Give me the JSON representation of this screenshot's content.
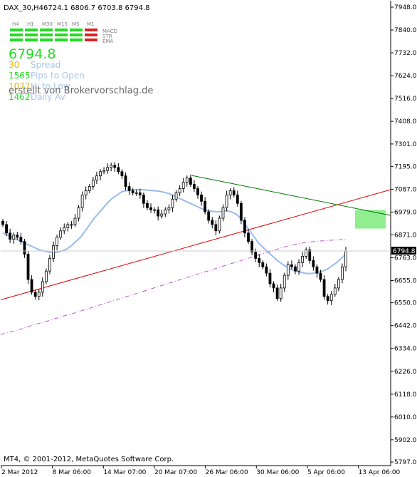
{
  "header": {
    "symbol": "DAX_30,H4",
    "ohlc": "6724.1 6806.7 6703.8 6794.8"
  },
  "indicator_panel": {
    "timeframes": [
      "H4",
      "H1",
      "M30",
      "M15",
      "M5",
      "M1"
    ],
    "signal_labels": [
      "MACD",
      "STR",
      "EMA"
    ],
    "signal_colors": {
      "H4": [
        "#22dd22",
        "#22dd22",
        "#22dd22"
      ],
      "H1": [
        "#22dd22",
        "#22dd22",
        "#22dd22"
      ],
      "M30": [
        "#22dd22",
        "#22dd22",
        "#22dd22"
      ],
      "M15": [
        "#22dd22",
        "#22dd22",
        "#22dd22"
      ],
      "M5": [
        "#22dd22",
        "#22dd22",
        "#22dd22"
      ],
      "M1": [
        "#dd2222",
        "#dd2222",
        "#dd2222"
      ]
    },
    "price": "6794.8",
    "stats": [
      {
        "value": "30",
        "label": "Spread",
        "value_color": "#e6b800"
      },
      {
        "value": "1565",
        "label": "Pips to Open",
        "value_color": "#22dd22"
      },
      {
        "value": "1077",
        "label": "Hi to Low",
        "value_color": "#e6b800"
      },
      {
        "value": "1462",
        "label": "Daily Av",
        "value_color": "#22dd22"
      }
    ]
  },
  "watermark": "erstellt von Brokervorschlag.de",
  "footer": "MT4, © 2001-2012, MetaQuotes Software Corp.",
  "chart_data": {
    "type": "candlestick",
    "y_ticks": [
      "7948.0",
      "7840.0",
      "7732.0",
      "7624.0",
      "7516.0",
      "7408.0",
      "7301.0",
      "7195.0",
      "7087.0",
      "6979.0",
      "6871.0",
      "6763.0",
      "6655.0",
      "6550.0",
      "6442.0",
      "6334.0",
      "6226.0",
      "6118.0",
      "6010.0",
      "5902.0",
      "5797.0"
    ],
    "ylim": [
      5797,
      7948
    ],
    "current_price": "6794.8",
    "x_ticks": [
      "2 Mar 2012",
      "8 Mar 06:00",
      "14 Mar 07:00",
      "20 Mar 07:00",
      "26 Mar 06:00",
      "30 Mar 06:00",
      "5 Apr 06:00",
      "13 Apr 06:00"
    ],
    "colors": {
      "candle": "#000000",
      "ma_fast": "#99bbee",
      "ma_slow": "#bb55cc",
      "support": "#dd0000",
      "resistance": "#007700",
      "box": "#90ee90"
    },
    "close": [
      6920,
      6880,
      6850,
      6870,
      6860,
      6840,
      6780,
      6660,
      6600,
      6580,
      6600,
      6650,
      6700,
      6760,
      6820,
      6860,
      6890,
      6905,
      6920,
      6920,
      6950,
      7000,
      7060,
      7080,
      7100,
      7130,
      7150,
      7170,
      7175,
      7190,
      7200,
      7190,
      7170,
      7150,
      7100,
      7080,
      7070,
      7070,
      7060,
      7020,
      7000,
      6990,
      6990,
      6960,
      6970,
      6990,
      7000,
      7040,
      7070,
      7090,
      7120,
      7140,
      7110,
      7090,
      7060,
      7030,
      6980,
      6940,
      6920,
      6890,
      6950,
      7000,
      7060,
      7080,
      7060,
      7020,
      6940,
      6880,
      6840,
      6790,
      6760,
      6740,
      6720,
      6690,
      6640,
      6620,
      6570,
      6620,
      6680,
      6730,
      6720,
      6700,
      6740,
      6770,
      6800,
      6750,
      6720,
      6690,
      6660,
      6580,
      6560,
      6590,
      6620,
      6660,
      6720,
      6794.8
    ],
    "ma_fast": [
      6880,
      6870,
      6860,
      6850,
      6840,
      6830,
      6820,
      6810,
      6800,
      6795,
      6790,
      6788,
      6790,
      6795,
      6805,
      6820,
      6840,
      6860,
      6890,
      6920,
      6950,
      6975,
      7000,
      7025,
      7045,
      7060,
      7075,
      7080,
      7085,
      7085,
      7085,
      7084,
      7082,
      7080,
      7078,
      7074,
      7068,
      7060,
      7050,
      7040,
      7030,
      7020,
      7010,
      7000,
      6990,
      6985,
      6982,
      6980,
      6982,
      6985,
      6980,
      6970,
      6950,
      6920,
      6890,
      6860,
      6830,
      6810,
      6790,
      6770,
      6750,
      6735,
      6720,
      6708,
      6700,
      6695,
      6690,
      6688,
      6690,
      6695,
      6700,
      6710,
      6725,
      6740,
      6760,
      6780
    ],
    "ma_slow": [
      6400,
      6410,
      6420,
      6432,
      6445,
      6455,
      6466,
      6478,
      6490,
      6500,
      6512,
      6524,
      6536,
      6548,
      6560,
      6572,
      6584,
      6596,
      6608,
      6620,
      6632,
      6644,
      6656,
      6668,
      6680,
      6692,
      6704,
      6716,
      6728,
      6740,
      6752,
      6764,
      6776,
      6788,
      6800,
      6812,
      6822,
      6830,
      6836,
      6840,
      6843,
      6846,
      6848,
      6850
    ],
    "support_line": [
      [
        0,
        6564
      ],
      [
        1,
        7085
      ]
    ],
    "resistance_line": [
      [
        0.49,
        7152
      ],
      [
        1,
        6963
      ]
    ],
    "target_zone": [
      6901,
      6989
    ]
  }
}
